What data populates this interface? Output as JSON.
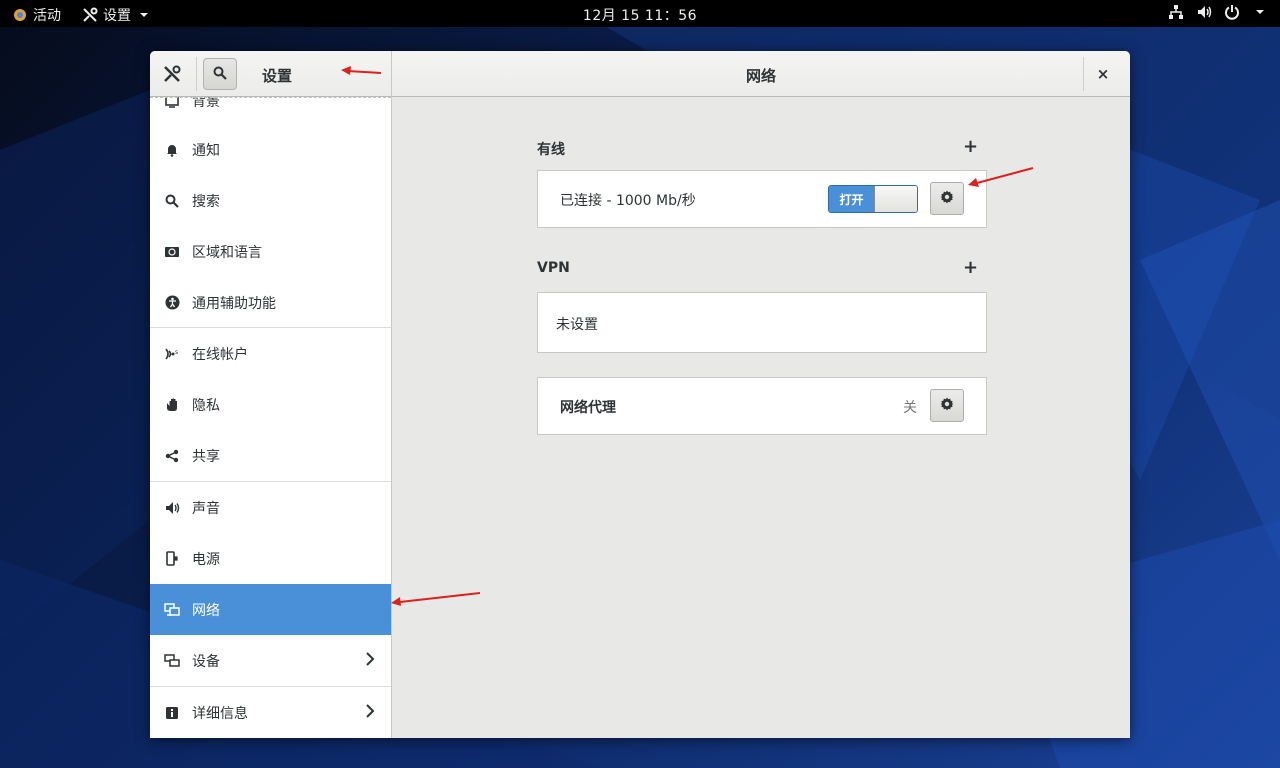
{
  "topbar": {
    "activities": "活动",
    "app_menu": "设置",
    "clock": "12月 15  11：56",
    "icons": [
      "network-wired-icon",
      "volume-icon",
      "power-icon",
      "chevron-down-icon"
    ]
  },
  "window": {
    "sidebar_title": "设置",
    "page_title": "网络",
    "close": "×"
  },
  "sidebar": {
    "items": [
      {
        "label": "背景",
        "icon": "background-icon"
      },
      {
        "label": "通知",
        "icon": "bell-icon"
      },
      {
        "label": "搜索",
        "icon": "search-icon"
      },
      {
        "label": "区域和语言",
        "icon": "region-icon"
      },
      {
        "label": "通用辅助功能",
        "icon": "accessibility-icon"
      },
      {
        "label": "在线帐户",
        "icon": "online-accounts-icon"
      },
      {
        "label": "隐私",
        "icon": "hand-icon"
      },
      {
        "label": "共享",
        "icon": "share-icon"
      },
      {
        "label": "声音",
        "icon": "speaker-icon"
      },
      {
        "label": "电源",
        "icon": "power-plug-icon"
      },
      {
        "label": "网络",
        "icon": "network-icon",
        "active": true
      },
      {
        "label": "设备",
        "icon": "devices-icon",
        "has_submenu": true
      },
      {
        "label": "详细信息",
        "icon": "info-icon",
        "has_submenu": true
      }
    ]
  },
  "main": {
    "wired": {
      "title": "有线",
      "add": "+",
      "status": "已连接 - 1000 Mb/秒",
      "switch_label": "打开"
    },
    "vpn": {
      "title": "VPN",
      "add": "+",
      "status": "未设置"
    },
    "proxy": {
      "title": "网络代理",
      "state": "关"
    }
  },
  "colors": {
    "accent": "#4a90d9",
    "annotation": "#e0201c"
  }
}
